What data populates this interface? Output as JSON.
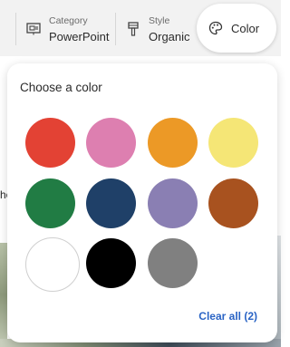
{
  "filters": [
    {
      "label": "Category",
      "value": "PowerPoint",
      "icon": "slides-icon"
    },
    {
      "label": "Style",
      "value": "Organic",
      "icon": "brush-icon"
    }
  ],
  "color_filter": {
    "value": "Color",
    "icon": "palette-icon"
  },
  "background": {
    "partial_text": "he"
  },
  "panel": {
    "title": "Choose a color",
    "colors": [
      {
        "name": "red",
        "hex": "#e34234"
      },
      {
        "name": "pink",
        "hex": "#dd7fb0"
      },
      {
        "name": "orange",
        "hex": "#ec9926"
      },
      {
        "name": "yellow",
        "hex": "#f5e676"
      },
      {
        "name": "green",
        "hex": "#217c44"
      },
      {
        "name": "navy",
        "hex": "#1f4068"
      },
      {
        "name": "purple",
        "hex": "#8a7fb3"
      },
      {
        "name": "brown",
        "hex": "#a8521f"
      },
      {
        "name": "white",
        "hex": "#ffffff"
      },
      {
        "name": "black",
        "hex": "#000000"
      },
      {
        "name": "gray",
        "hex": "#808080"
      }
    ],
    "clear_all": "Clear all (2)"
  }
}
